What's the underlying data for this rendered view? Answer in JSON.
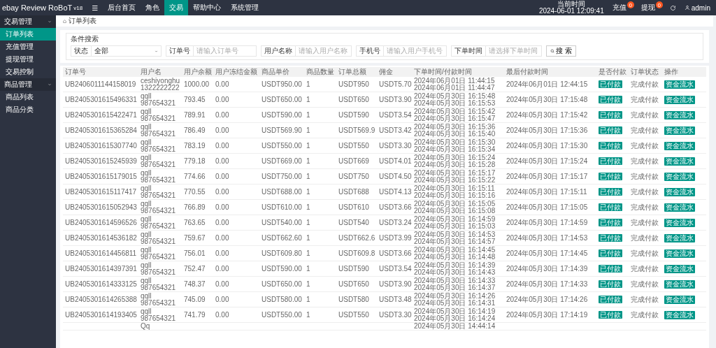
{
  "brand": {
    "name": "ebay Review RoBoT",
    "version": "v18"
  },
  "top_nav": [
    {
      "label": "☰",
      "selected": false
    },
    {
      "label": "后台首页",
      "selected": false
    },
    {
      "label": "角色",
      "selected": false
    },
    {
      "label": "交易",
      "selected": true
    },
    {
      "label": "帮助中心",
      "selected": false
    },
    {
      "label": "系统管理",
      "selected": false
    }
  ],
  "clock": {
    "label": "当前时间",
    "value": "2024-06-01 12:09:41"
  },
  "header_actions": [
    {
      "label": "充值",
      "badge": "0"
    },
    {
      "label": "提现",
      "badge": "0"
    }
  ],
  "user": "admin",
  "sidebar": [
    {
      "label": "交易管理",
      "expanded": true,
      "children": [
        {
          "label": "订单列表",
          "selected": true
        },
        {
          "label": "充值管理",
          "selected": false
        },
        {
          "label": "提现管理",
          "selected": false
        },
        {
          "label": "交易控制",
          "selected": false
        }
      ]
    },
    {
      "label": "商品管理",
      "expanded": true,
      "children": [
        {
          "label": "商品列表",
          "selected": false
        },
        {
          "label": "商品分类",
          "selected": false
        }
      ]
    }
  ],
  "breadcrumb": "订单列表",
  "search": {
    "title": "条件搜索",
    "status": {
      "label": "状态",
      "value": "全部"
    },
    "fields": [
      {
        "label": "订单号",
        "placeholder": "请输入订单号"
      },
      {
        "label": "用户名称",
        "placeholder": "请输入用户名称"
      },
      {
        "label": "手机号",
        "placeholder": "请输入用户手机号"
      },
      {
        "label": "下单时间",
        "placeholder": "请选择下单时间"
      }
    ],
    "button": "搜 索"
  },
  "table": {
    "columns": [
      "订单号",
      "用户名",
      "用户余额",
      "用户冻结金额",
      "商品单价",
      "商品数量",
      "订单总额",
      "佣金",
      "下单时间/付款时间",
      "最后付款时间",
      "是否付款",
      "订单状态",
      "操作"
    ],
    "rows": [
      {
        "order": "UB2406011144158019",
        "user": "ceshiyonghu",
        "phone": "1322222222",
        "balance": "1000.00",
        "frozen": "0.00",
        "price": "USDT950.00",
        "qty": "1",
        "total": "USDT950",
        "commission": "USDT5.70",
        "ordered": "2024年06月01日 11:44:15",
        "paid": "2024年06月01日 11:44:47",
        "last": "2024年06月01日 12:44:15",
        "pay_status": "已付款",
        "status": "完成付款",
        "action": "资金流水"
      },
      {
        "order": "UB2405301615496331",
        "user": "qqll",
        "phone": "987654321",
        "balance": "793.45",
        "frozen": "0.00",
        "price": "USDT650.00",
        "qty": "1",
        "total": "USDT650",
        "commission": "USDT3.90",
        "ordered": "2024年05月30日 16:15:48",
        "paid": "2024年05月30日 16:15:53",
        "last": "2024年05月30日 17:15:48",
        "pay_status": "已付款",
        "status": "完成付款",
        "action": "资金流水"
      },
      {
        "order": "UB2405301615422471",
        "user": "qqll",
        "phone": "987654321",
        "balance": "789.91",
        "frozen": "0.00",
        "price": "USDT590.00",
        "qty": "1",
        "total": "USDT590",
        "commission": "USDT3.54",
        "ordered": "2024年05月30日 16:15:42",
        "paid": "2024年05月30日 16:15:47",
        "last": "2024年05月30日 17:15:42",
        "pay_status": "已付款",
        "status": "完成付款",
        "action": "资金流水"
      },
      {
        "order": "UB2405301615365284",
        "user": "qqll",
        "phone": "987654321",
        "balance": "786.49",
        "frozen": "0.00",
        "price": "USDT569.90",
        "qty": "1",
        "total": "USDT569.9",
        "commission": "USDT3.42",
        "ordered": "2024年05月30日 16:15:36",
        "paid": "2024年05月30日 16:15:40",
        "last": "2024年05月30日 17:15:36",
        "pay_status": "已付款",
        "status": "完成付款",
        "action": "资金流水"
      },
      {
        "order": "UB2405301615307740",
        "user": "qqll",
        "phone": "987654321",
        "balance": "783.19",
        "frozen": "0.00",
        "price": "USDT550.00",
        "qty": "1",
        "total": "USDT550",
        "commission": "USDT3.30",
        "ordered": "2024年05月30日 16:15:30",
        "paid": "2024年05月30日 16:15:34",
        "last": "2024年05月30日 17:15:30",
        "pay_status": "已付款",
        "status": "完成付款",
        "action": "资金流水"
      },
      {
        "order": "UB2405301615245939",
        "user": "qqll",
        "phone": "987654321",
        "balance": "779.18",
        "frozen": "0.00",
        "price": "USDT669.00",
        "qty": "1",
        "total": "USDT669",
        "commission": "USDT4.01",
        "ordered": "2024年05月30日 16:15:24",
        "paid": "2024年05月30日 16:15:28",
        "last": "2024年05月30日 17:15:24",
        "pay_status": "已付款",
        "status": "完成付款",
        "action": "资金流水"
      },
      {
        "order": "UB2405301615179015",
        "user": "qqll",
        "phone": "987654321",
        "balance": "774.66",
        "frozen": "0.00",
        "price": "USDT750.00",
        "qty": "1",
        "total": "USDT750",
        "commission": "USDT4.50",
        "ordered": "2024年05月30日 16:15:17",
        "paid": "2024年05月30日 16:15:22",
        "last": "2024年05月30日 17:15:17",
        "pay_status": "已付款",
        "status": "完成付款",
        "action": "资金流水"
      },
      {
        "order": "UB2405301615117417",
        "user": "qqll",
        "phone": "987654321",
        "balance": "770.55",
        "frozen": "0.00",
        "price": "USDT688.00",
        "qty": "1",
        "total": "USDT688",
        "commission": "USDT4.13",
        "ordered": "2024年05月30日 16:15:11",
        "paid": "2024年05月30日 16:15:16",
        "last": "2024年05月30日 17:15:11",
        "pay_status": "已付款",
        "status": "完成付款",
        "action": "资金流水"
      },
      {
        "order": "UB2405301615052943",
        "user": "qqll",
        "phone": "987654321",
        "balance": "766.89",
        "frozen": "0.00",
        "price": "USDT610.00",
        "qty": "1",
        "total": "USDT610",
        "commission": "USDT3.66",
        "ordered": "2024年05月30日 16:15:05",
        "paid": "2024年05月30日 16:15:08",
        "last": "2024年05月30日 17:15:05",
        "pay_status": "已付款",
        "status": "完成付款",
        "action": "资金流水"
      },
      {
        "order": "UB2405301614596526",
        "user": "qqll",
        "phone": "987654321",
        "balance": "763.65",
        "frozen": "0.00",
        "price": "USDT540.00",
        "qty": "1",
        "total": "USDT540",
        "commission": "USDT3.24",
        "ordered": "2024年05月30日 16:14:59",
        "paid": "2024年05月30日 16:15:03",
        "last": "2024年05月30日 17:14:59",
        "pay_status": "已付款",
        "status": "完成付款",
        "action": "资金流水"
      },
      {
        "order": "UB2405301614536182",
        "user": "qqll",
        "phone": "987654321",
        "balance": "759.67",
        "frozen": "0.00",
        "price": "USDT662.60",
        "qty": "1",
        "total": "USDT662.6",
        "commission": "USDT3.99",
        "ordered": "2024年05月30日 16:14:53",
        "paid": "2024年05月30日 16:14:57",
        "last": "2024年05月30日 17:14:53",
        "pay_status": "已付款",
        "status": "完成付款",
        "action": "资金流水"
      },
      {
        "order": "UB2405301614456811",
        "user": "qqll",
        "phone": "987654321",
        "balance": "756.01",
        "frozen": "0.00",
        "price": "USDT609.80",
        "qty": "1",
        "total": "USDT609.8",
        "commission": "USDT3.66",
        "ordered": "2024年05月30日 16:14:45",
        "paid": "2024年05月30日 16:14:48",
        "last": "2024年05月30日 17:14:45",
        "pay_status": "已付款",
        "status": "完成付款",
        "action": "资金流水"
      },
      {
        "order": "UB2405301614397391",
        "user": "qqll",
        "phone": "987654321",
        "balance": "752.47",
        "frozen": "0.00",
        "price": "USDT590.00",
        "qty": "1",
        "total": "USDT590",
        "commission": "USDT3.54",
        "ordered": "2024年05月30日 16:14:39",
        "paid": "2024年05月30日 16:14:43",
        "last": "2024年05月30日 17:14:39",
        "pay_status": "已付款",
        "status": "完成付款",
        "action": "资金流水"
      },
      {
        "order": "UB2405301614333125",
        "user": "qqll",
        "phone": "987654321",
        "balance": "748.37",
        "frozen": "0.00",
        "price": "USDT650.00",
        "qty": "1",
        "total": "USDT650",
        "commission": "USDT3.90",
        "ordered": "2024年05月30日 16:14:33",
        "paid": "2024年05月30日 16:14:37",
        "last": "2024年05月30日 17:14:33",
        "pay_status": "已付款",
        "status": "完成付款",
        "action": "资金流水"
      },
      {
        "order": "UB2405301614265388",
        "user": "qqll",
        "phone": "987654321",
        "balance": "745.09",
        "frozen": "0.00",
        "price": "USDT580.00",
        "qty": "1",
        "total": "USDT580",
        "commission": "USDT3.48",
        "ordered": "2024年05月30日 16:14:26",
        "paid": "2024年05月30日 16:14:31",
        "last": "2024年05月30日 17:14:26",
        "pay_status": "已付款",
        "status": "完成付款",
        "action": "资金流水"
      },
      {
        "order": "UB2405301614193405",
        "user": "qqll",
        "phone": "987654321",
        "balance": "741.79",
        "frozen": "0.00",
        "price": "USDT550.00",
        "qty": "1",
        "total": "USDT550",
        "commission": "USDT3.30",
        "ordered": "2024年05月30日 16:14:19",
        "paid": "2024年05月30日 16:14:24",
        "last": "2024年05月30日 17:14:19",
        "pay_status": "已付款",
        "status": "完成付款",
        "action": "资金流水"
      },
      {
        "user": "Qq",
        "ordered": "2024年05月30日 14:44:14"
      }
    ]
  }
}
